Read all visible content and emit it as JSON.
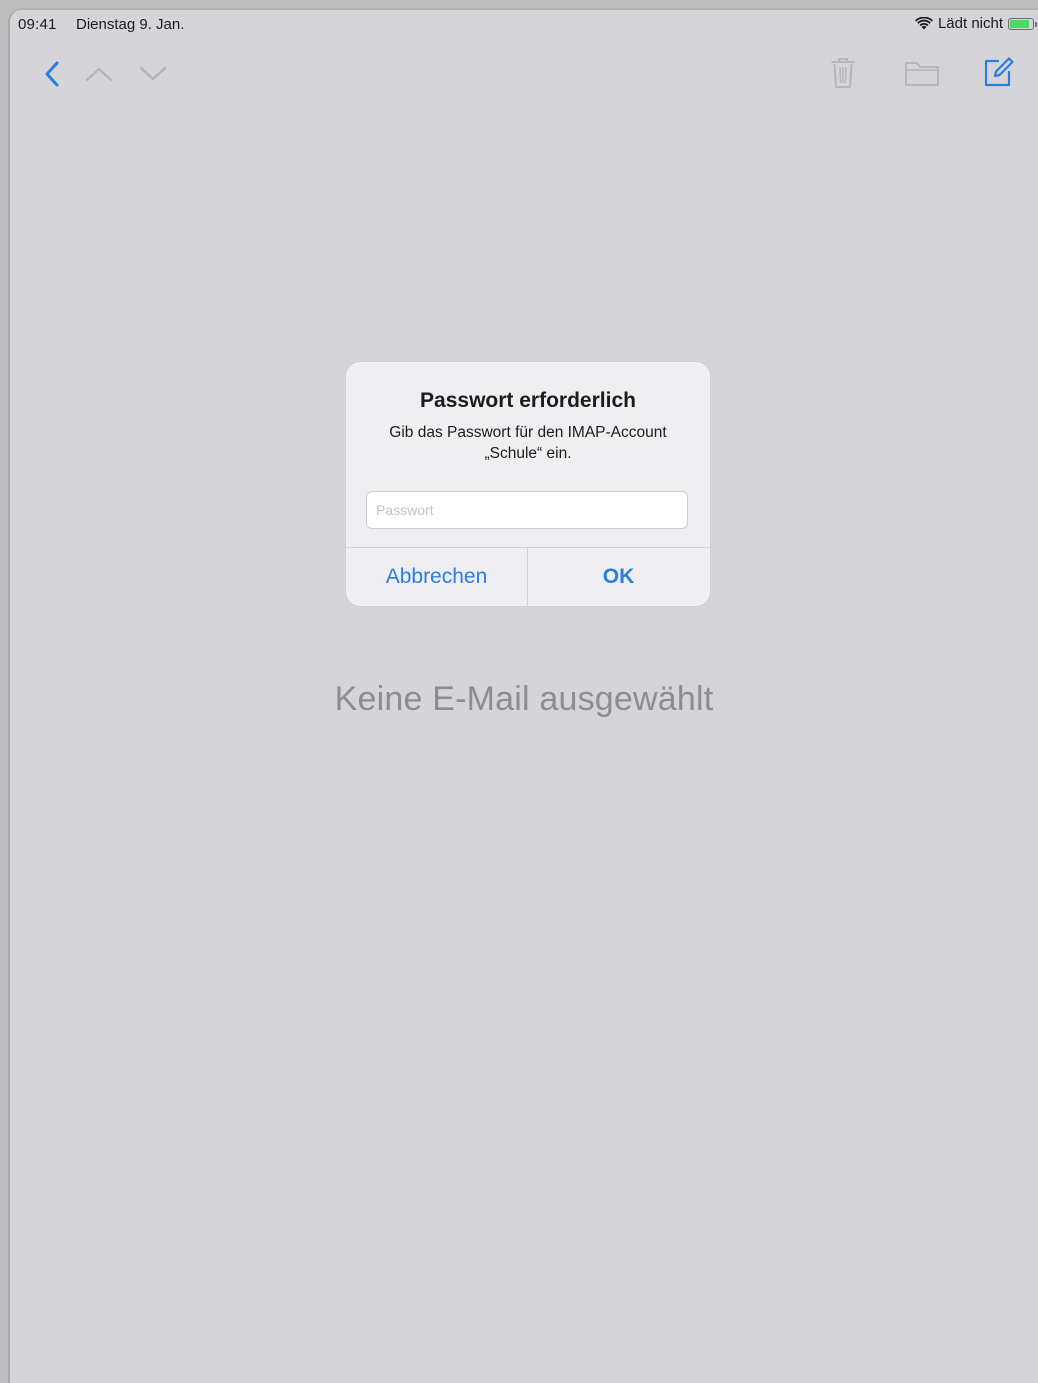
{
  "status_bar": {
    "time": "09:41",
    "date": "Dienstag 9. Jan.",
    "charging_text": "Lädt nicht",
    "icons": [
      "wifi-icon",
      "battery-icon"
    ],
    "battery_color": "#4cd964"
  },
  "toolbar": {
    "left_icons": [
      "back-chevron-icon",
      "previous-message-icon",
      "next-message-icon"
    ],
    "right_icons": [
      "trash-icon",
      "folder-icon",
      "compose-icon"
    ],
    "accent_color": "#2a7ee0",
    "disabled_color": "#b4b3b8"
  },
  "main": {
    "empty_message": "Keine E-Mail ausgewählt"
  },
  "alert": {
    "title": "Passwort erforderlich",
    "message": "Gib das Passwort für den IMAP-Account „Schule“ ein.",
    "input_placeholder": "Passwort",
    "input_value": "",
    "cancel_label": "Abbrechen",
    "ok_label": "OK"
  }
}
